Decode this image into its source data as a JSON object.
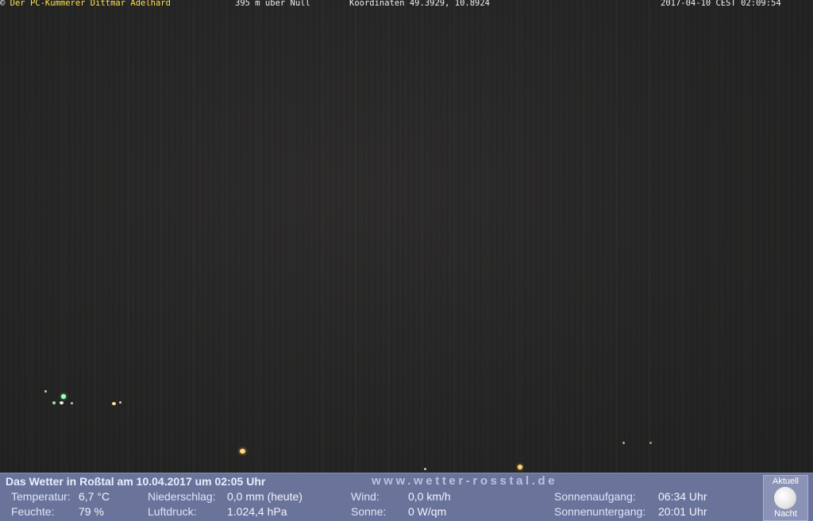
{
  "overlay": {
    "copyright_symbol": "©",
    "credit": "Der PC-Kümmerer Dittmar Adelhard",
    "altitude": "395 m über Null",
    "coordinates": "Koordinaten 49.3929, 10.8924",
    "datetime": "2017-04-10 CEST 02:09:54"
  },
  "weather": {
    "title": "Das Wetter in Roßtal am 10.04.2017 um 02:05 Uhr",
    "url": "www.wetter-rosstal.de",
    "temperature": {
      "label": "Temperatur:",
      "value": "6,7 °C"
    },
    "humidity": {
      "label": "Feuchte:",
      "value": "79 %"
    },
    "precipitation": {
      "label": "Niederschlag:",
      "value": "0,0 mm (heute)"
    },
    "pressure": {
      "label": "Luftdruck:",
      "value": "1.024,4 hPa"
    },
    "wind": {
      "label": "Wind:",
      "value": "0,0 km/h"
    },
    "sun": {
      "label": "Sonne:",
      "value": "0 W/qm"
    },
    "sunrise": {
      "label": "Sonnenaufgang:",
      "value": "06:34 Uhr"
    },
    "sunset": {
      "label": "Sonnenuntergang:",
      "value": "20:01 Uhr"
    },
    "moon": {
      "top_label": "Aktuell",
      "bottom_label": "Nacht",
      "icon": "moon-icon"
    }
  },
  "colors": {
    "credit_text": "#ffe24a",
    "weather_bar": "#6a749a",
    "light_warm": "#ffd27a",
    "light_green": "#8fffb0"
  }
}
